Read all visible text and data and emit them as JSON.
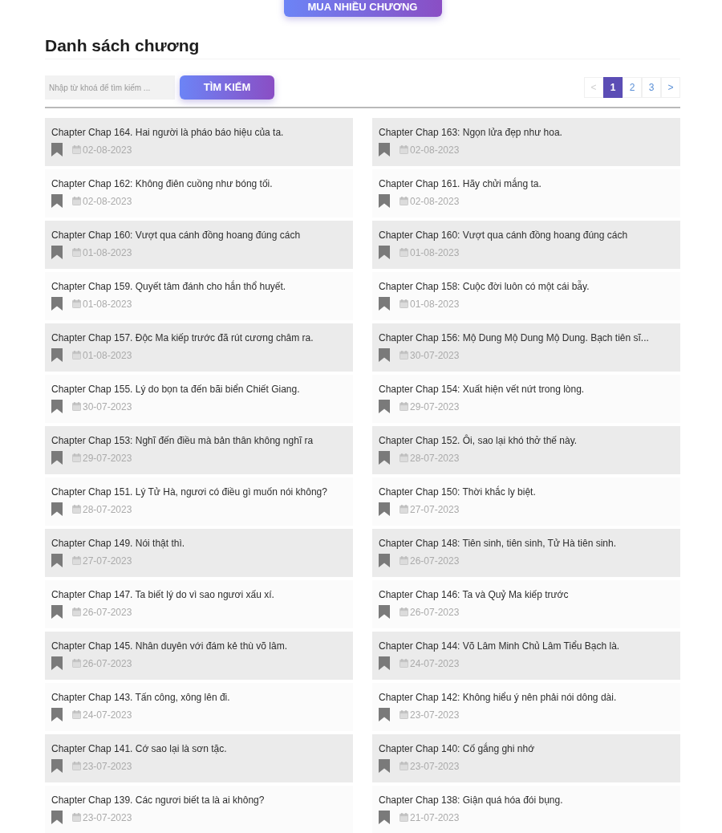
{
  "header": {
    "buy_button": "MUA NHIỀU CHƯƠNG",
    "title": "Danh sách chương"
  },
  "search": {
    "placeholder": "Nhập từ khoá để tìm kiếm ...",
    "button": "TÌM KIẾM"
  },
  "pagination": [
    {
      "label": "<",
      "selected": false,
      "disabled": true
    },
    {
      "label": "1",
      "selected": true,
      "disabled": false
    },
    {
      "label": "2",
      "selected": false,
      "disabled": false
    },
    {
      "label": "3",
      "selected": false,
      "disabled": false
    },
    {
      "label": ">",
      "selected": false,
      "disabled": false
    }
  ],
  "chapters": [
    {
      "title": "Chapter Chap 164. Hai người là pháo báo hiệu của ta.",
      "date": "02-08-2023"
    },
    {
      "title": "Chapter Chap 163: Ngọn lửa đẹp như hoa.",
      "date": "02-08-2023"
    },
    {
      "title": "Chapter Chap 162: Không điên cuồng như bóng tối.",
      "date": "02-08-2023"
    },
    {
      "title": "Chapter Chap 161. Hãy chửi mắng ta.",
      "date": "02-08-2023"
    },
    {
      "title": "Chapter Chap 160: Vượt qua cánh đồng hoang đúng cách",
      "date": "01-08-2023"
    },
    {
      "title": "Chapter Chap 160: Vượt qua cánh đồng hoang đúng cách",
      "date": "01-08-2023"
    },
    {
      "title": "Chapter Chap 159. Quyết tâm đánh cho hắn thổ huyết.",
      "date": "01-08-2023"
    },
    {
      "title": "Chapter Chap 158: Cuộc đời luôn có một cái bẫy.",
      "date": "01-08-2023"
    },
    {
      "title": "Chapter Chap 157. Độc Ma kiếp trước đã rút cương châm ra.",
      "date": "01-08-2023"
    },
    {
      "title": "Chapter Chap 156: Mộ Dung Mộ Dung Mộ Dung. Bạch tiên sĩ...",
      "date": "30-07-2023"
    },
    {
      "title": "Chapter Chap 155. Lý do bọn ta đến bãi biển Chiết Giang.",
      "date": "30-07-2023"
    },
    {
      "title": "Chapter Chap 154: Xuất hiện vết nứt trong lòng.",
      "date": "29-07-2023"
    },
    {
      "title": "Chapter Chap 153: Nghĩ đến điều mà bản thân không nghĩ ra",
      "date": "29-07-2023"
    },
    {
      "title": "Chapter Chap 152. Ôi, sao lại khó thở thế này.",
      "date": "28-07-2023"
    },
    {
      "title": "Chapter Chap 151. Lý Tử Hà, ngươi có điều gì muốn nói không?",
      "date": "28-07-2023"
    },
    {
      "title": "Chapter Chap 150: Thời khắc ly biệt.",
      "date": "27-07-2023"
    },
    {
      "title": "Chapter Chap 149. Nói thật thì.",
      "date": "27-07-2023"
    },
    {
      "title": "Chapter Chap 148: Tiên sinh, tiên sinh, Tử Hà tiên sinh.",
      "date": "26-07-2023"
    },
    {
      "title": "Chapter Chap 147. Ta biết lý do vì sao ngươi xấu xí.",
      "date": "26-07-2023"
    },
    {
      "title": "Chapter Chap 146: Ta và Quỷ Ma kiếp trước",
      "date": "26-07-2023"
    },
    {
      "title": "Chapter Chap 145. Nhân duyên với đám kẻ thù võ lâm.",
      "date": "26-07-2023"
    },
    {
      "title": "Chapter Chap 144: Võ Lâm Minh Chủ Lâm Tiểu Bạch là.",
      "date": "24-07-2023"
    },
    {
      "title": "Chapter Chap 143. Tấn công, xông lên đi.",
      "date": "24-07-2023"
    },
    {
      "title": "Chapter Chap 142: Không hiểu ý nên phải nói dông dài.",
      "date": "23-07-2023"
    },
    {
      "title": "Chapter Chap 141. Cớ sao lại là sơn tặc.",
      "date": "23-07-2023"
    },
    {
      "title": "Chapter Chap 140: Cố gắng ghi nhớ",
      "date": "23-07-2023"
    },
    {
      "title": "Chapter Chap 139. Các ngươi biết ta là ai không?",
      "date": "23-07-2023"
    },
    {
      "title": "Chapter Chap 138: Giận quá hóa đói bụng.",
      "date": "21-07-2023"
    }
  ]
}
